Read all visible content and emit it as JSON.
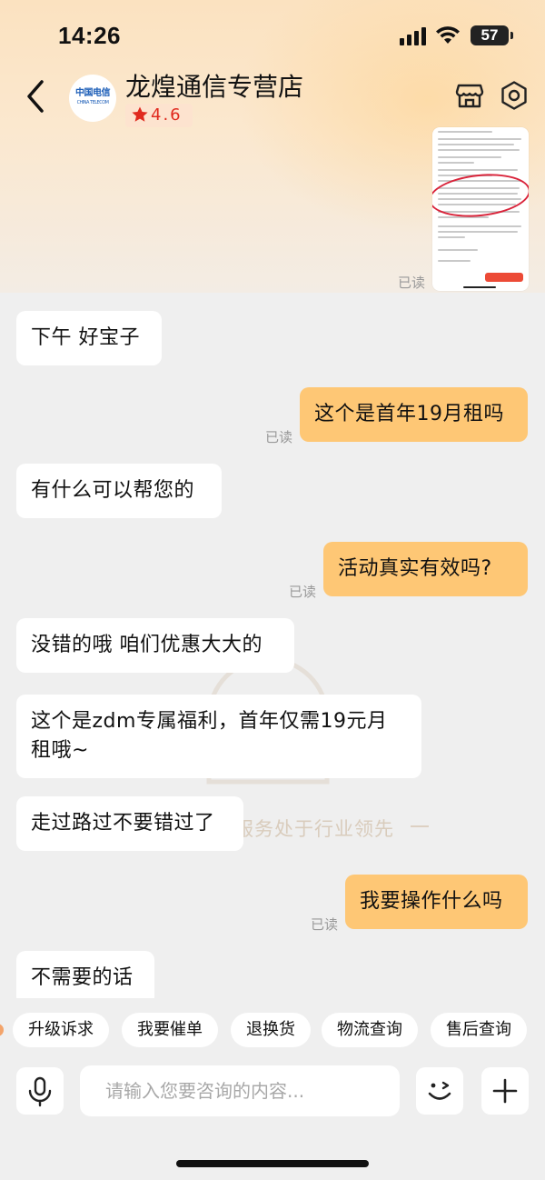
{
  "status_bar": {
    "time": "14:26",
    "battery": "57"
  },
  "header": {
    "shop_name": "龙煌通信专营店",
    "rating": "4.6",
    "logo_text": "中国电信",
    "logo_sub": "CHINA TELECOM",
    "read_label": "已读"
  },
  "watermark": {
    "text": "服务处于行业领先"
  },
  "messages": [
    {
      "side": "left",
      "text": "下午 好宝子"
    },
    {
      "side": "right",
      "text": "这个是首年19月租吗",
      "status": "已读"
    },
    {
      "side": "left",
      "text": "有什么可以帮您的"
    },
    {
      "side": "right",
      "text": "活动真实有效吗?",
      "status": "已读"
    },
    {
      "side": "left",
      "text": "没错的哦 咱们优惠大大的"
    },
    {
      "side": "left",
      "text": "这个是zdm专属福利，首年仅需19元月租哦~"
    },
    {
      "side": "left",
      "text": "走过路过不要错过了"
    },
    {
      "side": "right",
      "text": "我要操作什么吗",
      "status": "已读"
    },
    {
      "side": "left",
      "text": "不需要的话"
    }
  ],
  "quick_replies": [
    "升级诉求",
    "我要催单",
    "退换货",
    "物流查询",
    "售后查询"
  ],
  "input": {
    "placeholder": "请输入您要咨询的内容..."
  },
  "colors": {
    "header_bg": "#fbe2c0",
    "bubble_right": "#fec775",
    "bubble_left": "#ffffff",
    "rating_text": "#e02a1e",
    "chat_bg": "#efefef"
  },
  "icons": [
    "back-icon",
    "store-icon",
    "settings-icon",
    "microphone-icon",
    "emoji-icon",
    "plus-icon",
    "star-icon"
  ]
}
